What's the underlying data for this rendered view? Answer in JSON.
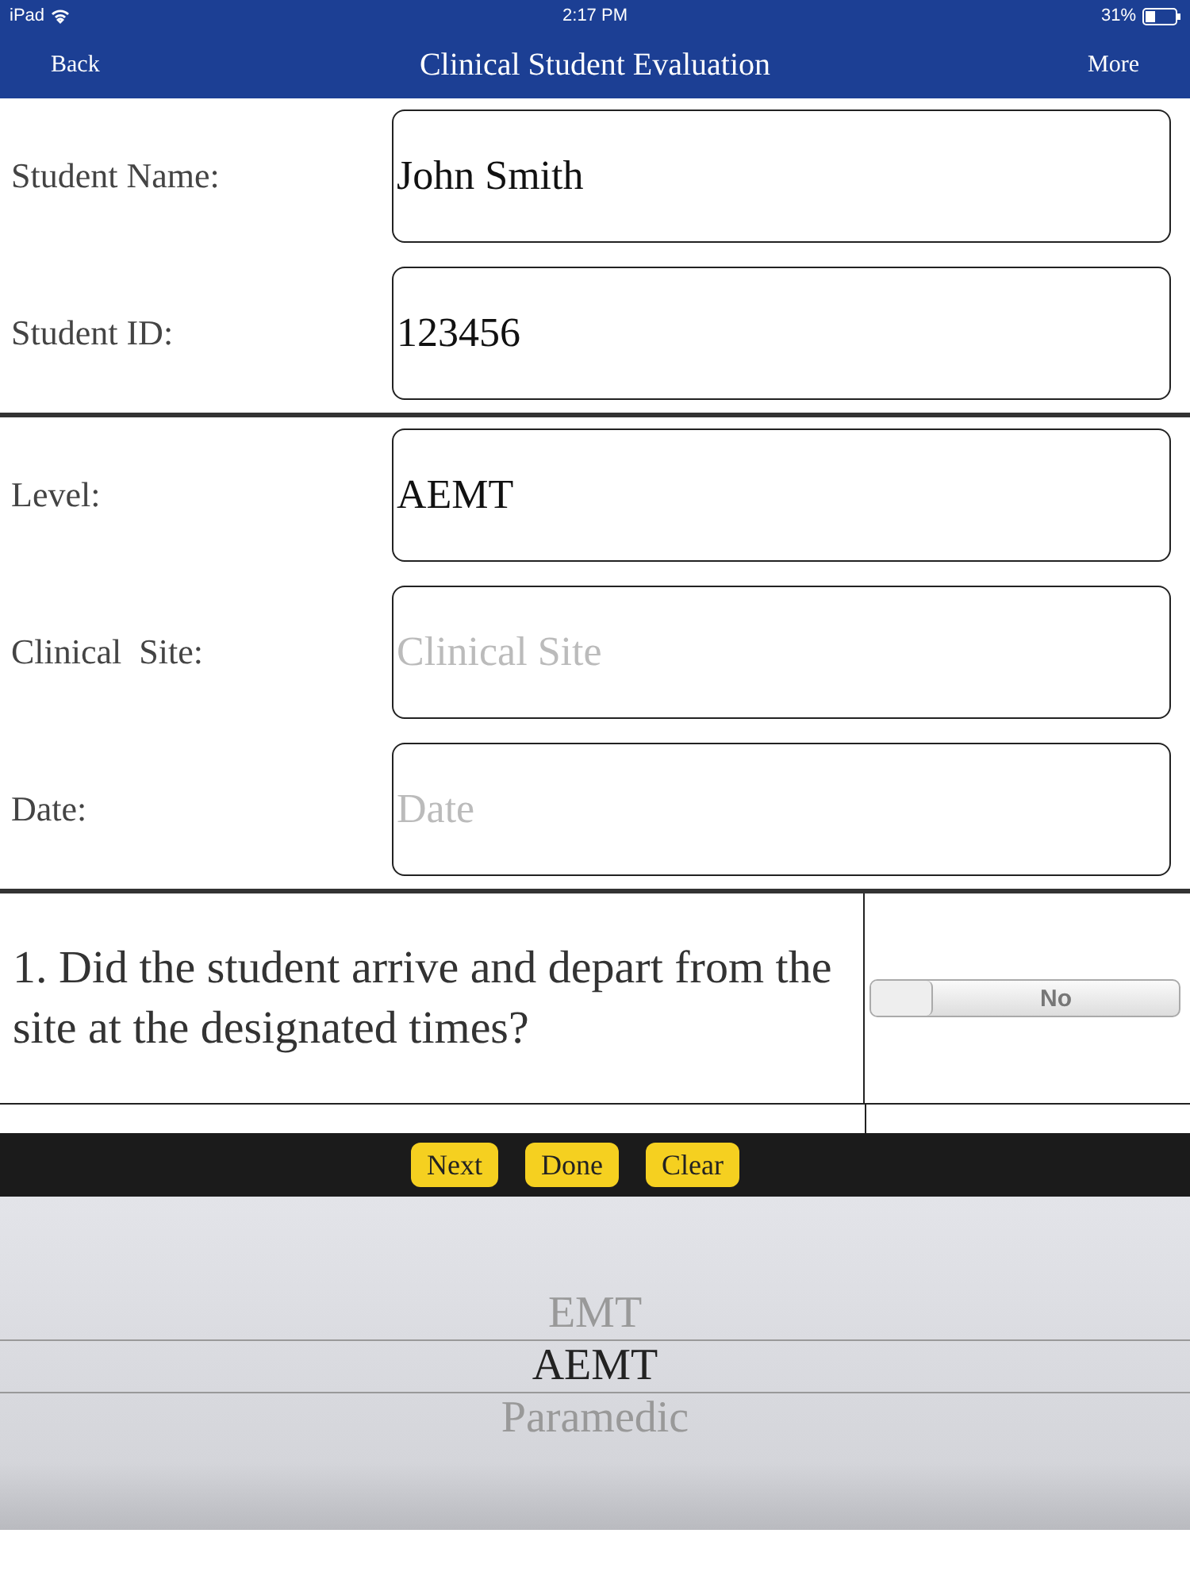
{
  "status_bar": {
    "device": "iPad",
    "time": "2:17 PM",
    "battery": "31%"
  },
  "nav_bar": {
    "back": "Back",
    "title": "Clinical Student Evaluation",
    "more": "More"
  },
  "sections": [
    {
      "fields": [
        {
          "label": "Student Name:",
          "value": "John Smith"
        },
        {
          "label": "Student ID:",
          "value": "123456"
        }
      ]
    },
    {
      "fields": [
        {
          "label": "Level:",
          "value": "AEMT"
        },
        {
          "label": "Clinical  Site:",
          "placeholder": "Clinical Site"
        },
        {
          "label": "Date:",
          "placeholder": "Date"
        }
      ]
    }
  ],
  "questions": [
    {
      "text": "1. Did the student arrive and depart from the site at the designated times?",
      "on": false,
      "switch_label": "No"
    }
  ],
  "toolbar": {
    "buttons": [
      "Next",
      "Done",
      "Clear"
    ]
  },
  "picker": {
    "options": [
      {
        "label": "EMT",
        "selected": false
      },
      {
        "label": "AEMT",
        "selected": true
      },
      {
        "label": "Paramedic",
        "selected": false
      }
    ]
  }
}
